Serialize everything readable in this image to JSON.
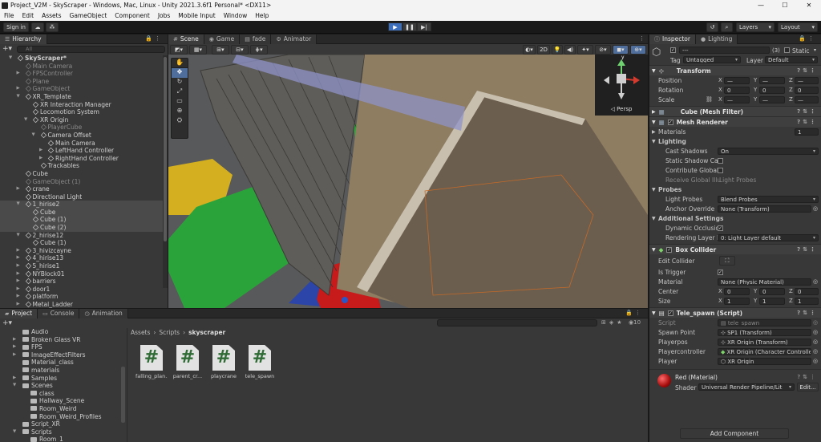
{
  "titlebar": {
    "title": "Project_V2M - SkyScraper - Windows, Mac, Linux - Unity 2021.3.6f1 Personal* <DX11>",
    "min": "—",
    "max": "☐",
    "close": "✕"
  },
  "menu": [
    "File",
    "Edit",
    "Assets",
    "GameObject",
    "Component",
    "Jobs",
    "Mobile Input",
    "Window",
    "Help"
  ],
  "toolbar": {
    "sign_in": "Sign in",
    "layers": "Layers",
    "layout": "Layout"
  },
  "hierarchy": {
    "tab": "Hierarchy",
    "search_placeholder": "All",
    "items": [
      {
        "label": "SkyScraper*",
        "indent": 0,
        "arrow": "▼",
        "dim": false,
        "scene": true
      },
      {
        "label": "Main Camera",
        "indent": 1,
        "arrow": "",
        "dim": true
      },
      {
        "label": "FPSController",
        "indent": 1,
        "arrow": "▶",
        "dim": true
      },
      {
        "label": "Plane",
        "indent": 1,
        "arrow": "",
        "dim": true
      },
      {
        "label": "GameObject",
        "indent": 1,
        "arrow": "▶",
        "dim": true
      },
      {
        "label": "XR_Template",
        "indent": 1,
        "arrow": "▼",
        "dim": false
      },
      {
        "label": "XR Interaction Manager",
        "indent": 2,
        "arrow": "",
        "dim": false
      },
      {
        "label": "Locomotion System",
        "indent": 2,
        "arrow": "",
        "dim": false
      },
      {
        "label": "XR Origin",
        "indent": 2,
        "arrow": "▼",
        "dim": false
      },
      {
        "label": "PlayerCube",
        "indent": 3,
        "arrow": "",
        "dim": true
      },
      {
        "label": "Camera Offset",
        "indent": 3,
        "arrow": "▼",
        "dim": false
      },
      {
        "label": "Main Camera",
        "indent": 4,
        "arrow": "",
        "dim": false
      },
      {
        "label": "LeftHand Controller",
        "indent": 4,
        "arrow": "▶",
        "dim": false
      },
      {
        "label": "RightHand Controller",
        "indent": 4,
        "arrow": "▶",
        "dim": false
      },
      {
        "label": "Trackables",
        "indent": 3,
        "arrow": "",
        "dim": false
      },
      {
        "label": "Cube",
        "indent": 1,
        "arrow": "",
        "dim": false
      },
      {
        "label": "GameObject (1)",
        "indent": 1,
        "arrow": "",
        "dim": true
      },
      {
        "label": "crane",
        "indent": 1,
        "arrow": "▶",
        "dim": false
      },
      {
        "label": "Directional Light",
        "indent": 1,
        "arrow": "",
        "dim": false
      },
      {
        "label": "1_hirise2",
        "indent": 1,
        "arrow": "▼",
        "dim": false,
        "sel": true
      },
      {
        "label": "Cube",
        "indent": 2,
        "arrow": "",
        "dim": false,
        "sel": true
      },
      {
        "label": "Cube (1)",
        "indent": 2,
        "arrow": "",
        "dim": false,
        "sel": true
      },
      {
        "label": "Cube (2)",
        "indent": 2,
        "arrow": "",
        "dim": false,
        "sel": true
      },
      {
        "label": "2_hirise12",
        "indent": 1,
        "arrow": "▼",
        "dim": false
      },
      {
        "label": "Cube (1)",
        "indent": 2,
        "arrow": "",
        "dim": false
      },
      {
        "label": "3_hivizcayne",
        "indent": 1,
        "arrow": "▶",
        "dim": false
      },
      {
        "label": "4_hirise13",
        "indent": 1,
        "arrow": "▶",
        "dim": false
      },
      {
        "label": "5_hirise1",
        "indent": 1,
        "arrow": "▶",
        "dim": false
      },
      {
        "label": "NYBlock01",
        "indent": 1,
        "arrow": "▶",
        "dim": false
      },
      {
        "label": "barriers",
        "indent": 1,
        "arrow": "▶",
        "dim": false
      },
      {
        "label": "door1",
        "indent": 1,
        "arrow": "▶",
        "dim": false
      },
      {
        "label": "platform",
        "indent": 1,
        "arrow": "▶",
        "dim": false
      },
      {
        "label": "Metal_Ladder",
        "indent": 1,
        "arrow": "▶",
        "dim": false
      }
    ]
  },
  "scene": {
    "tabs": [
      "Scene",
      "Game",
      "fade",
      "Animator"
    ],
    "mode_2d": "2D",
    "persp": "Persp",
    "axis_y": "y"
  },
  "inspector": {
    "tabs": [
      "Inspector",
      "Lighting"
    ],
    "object_name": "---",
    "count": "(3)",
    "static": "Static",
    "tag_label": "Tag",
    "tag_value": "Untagged",
    "layer_label": "Layer",
    "layer_value": "Default",
    "transform": {
      "title": "Transform",
      "position": "Position",
      "rotation": "Rotation",
      "scale": "Scale",
      "pos": [
        "—",
        "—",
        "—"
      ],
      "rot": [
        "0",
        "0",
        "0"
      ],
      "scl": [
        "—",
        "—",
        "—"
      ]
    },
    "mesh_filter": {
      "title": "Cube (Mesh Filter)"
    },
    "mesh_renderer": {
      "title": "Mesh Renderer",
      "materials": "Materials",
      "materials_count": "1",
      "lighting": "Lighting",
      "cast_shadows": "Cast Shadows",
      "cast_shadows_value": "On",
      "static_shadow": "Static Shadow Cas",
      "contribute_gi": "Contribute Global I",
      "receive_gi": "Receive Global Illu",
      "receive_gi_value": "Light Probes",
      "probes": "Probes",
      "light_probes": "Light Probes",
      "light_probes_value": "Blend Probes",
      "anchor": "Anchor Override",
      "anchor_value": "None (Transform)",
      "additional": "Additional Settings",
      "dynamic_occ": "Dynamic Occlusio",
      "rendering_layer": "Rendering Layer M",
      "rendering_layer_value": "0: Light Layer default"
    },
    "box_collider": {
      "title": "Box Collider",
      "edit_collider": "Edit Collider",
      "is_trigger": "Is Trigger",
      "material": "Material",
      "material_value": "None (Physic Material)",
      "center": "Center",
      "center_vals": [
        "0",
        "0",
        "0"
      ],
      "size": "Size",
      "size_vals": [
        "1",
        "1",
        "1"
      ]
    },
    "tele_spawn": {
      "title": "Tele_spawn (Script)",
      "script": "Script",
      "script_value": "tele_spawn",
      "spawn_point": "Spawn Point",
      "spawn_point_value": "SP1 (Transform)",
      "playerpos": "Playerpos",
      "playerpos_value": "XR Origin (Transform)",
      "playercontroller": "Playercontroller",
      "playercontroller_value": "XR Origin (Character Controller)",
      "player": "Player",
      "player_value": "XR Origin"
    },
    "material": {
      "title": "Red (Material)",
      "shader_label": "Shader",
      "shader_value": "Universal Render Pipeline/Lit",
      "edit": "Edit..."
    },
    "add_component": "Add Component"
  },
  "project": {
    "tabs": [
      "Project",
      "Console",
      "Animation"
    ],
    "breadcrumb": [
      "Assets",
      "Scripts",
      "skyscraper"
    ],
    "count": "10",
    "tree": [
      {
        "label": "Audio",
        "indent": 1,
        "arrow": ""
      },
      {
        "label": "Broken Glass VR",
        "indent": 1,
        "arrow": "▶"
      },
      {
        "label": "FPS",
        "indent": 1,
        "arrow": "▶"
      },
      {
        "label": "ImageEffectFilters",
        "indent": 1,
        "arrow": "▶"
      },
      {
        "label": "Material_class",
        "indent": 1,
        "arrow": ""
      },
      {
        "label": "materials",
        "indent": 1,
        "arrow": ""
      },
      {
        "label": "Samples",
        "indent": 1,
        "arrow": "▶"
      },
      {
        "label": "Scenes",
        "indent": 1,
        "arrow": "▼"
      },
      {
        "label": "class",
        "indent": 2,
        "arrow": ""
      },
      {
        "label": "Hallway_Scene",
        "indent": 2,
        "arrow": ""
      },
      {
        "label": "Room_Weird",
        "indent": 2,
        "arrow": ""
      },
      {
        "label": "Room_Weird_Profiles",
        "indent": 2,
        "arrow": ""
      },
      {
        "label": "Script_XR",
        "indent": 1,
        "arrow": ""
      },
      {
        "label": "Scripts",
        "indent": 1,
        "arrow": "▼"
      },
      {
        "label": "Room_1",
        "indent": 2,
        "arrow": ""
      }
    ],
    "assets": [
      {
        "label": "falling_plan...",
        "glyph": "#"
      },
      {
        "label": "parent_cr...",
        "glyph": "#"
      },
      {
        "label": "playcrane",
        "glyph": "#"
      },
      {
        "label": "tele_spawn",
        "glyph": "#"
      }
    ]
  }
}
